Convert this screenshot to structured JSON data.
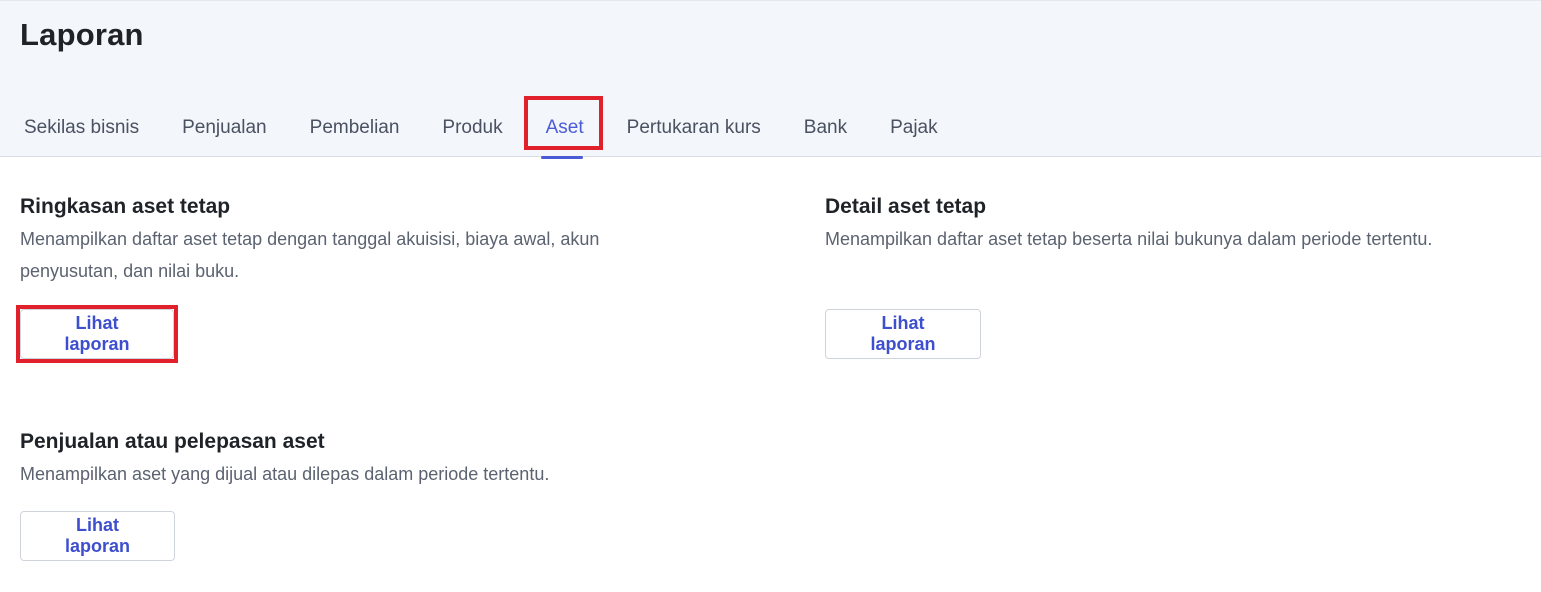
{
  "header": {
    "title": "Laporan"
  },
  "tabs": [
    {
      "label": "Sekilas bisnis",
      "active": false
    },
    {
      "label": "Penjualan",
      "active": false
    },
    {
      "label": "Pembelian",
      "active": false
    },
    {
      "label": "Produk",
      "active": false
    },
    {
      "label": "Aset",
      "active": true
    },
    {
      "label": "Pertukaran kurs",
      "active": false
    },
    {
      "label": "Bank",
      "active": false
    },
    {
      "label": "Pajak",
      "active": false
    }
  ],
  "reports": [
    {
      "title": "Ringkasan aset tetap",
      "description": "Menampilkan daftar aset tetap dengan tanggal akuisisi, biaya awal, akun penyusutan, dan nilai buku.",
      "button_label": "Lihat laporan"
    },
    {
      "title": "Detail aset tetap",
      "description": "Menampilkan daftar aset tetap beserta nilai bukunya dalam periode tertentu.",
      "button_label": "Lihat laporan"
    },
    {
      "title": "Penjualan atau pelepasan aset",
      "description": "Menampilkan aset yang dijual atau dilepas dalam periode tertentu.",
      "button_label": "Lihat laporan"
    }
  ],
  "colors": {
    "accent": "#4b5bd6",
    "highlight": "#e0202a",
    "header_bg": "#f3f6fb"
  }
}
